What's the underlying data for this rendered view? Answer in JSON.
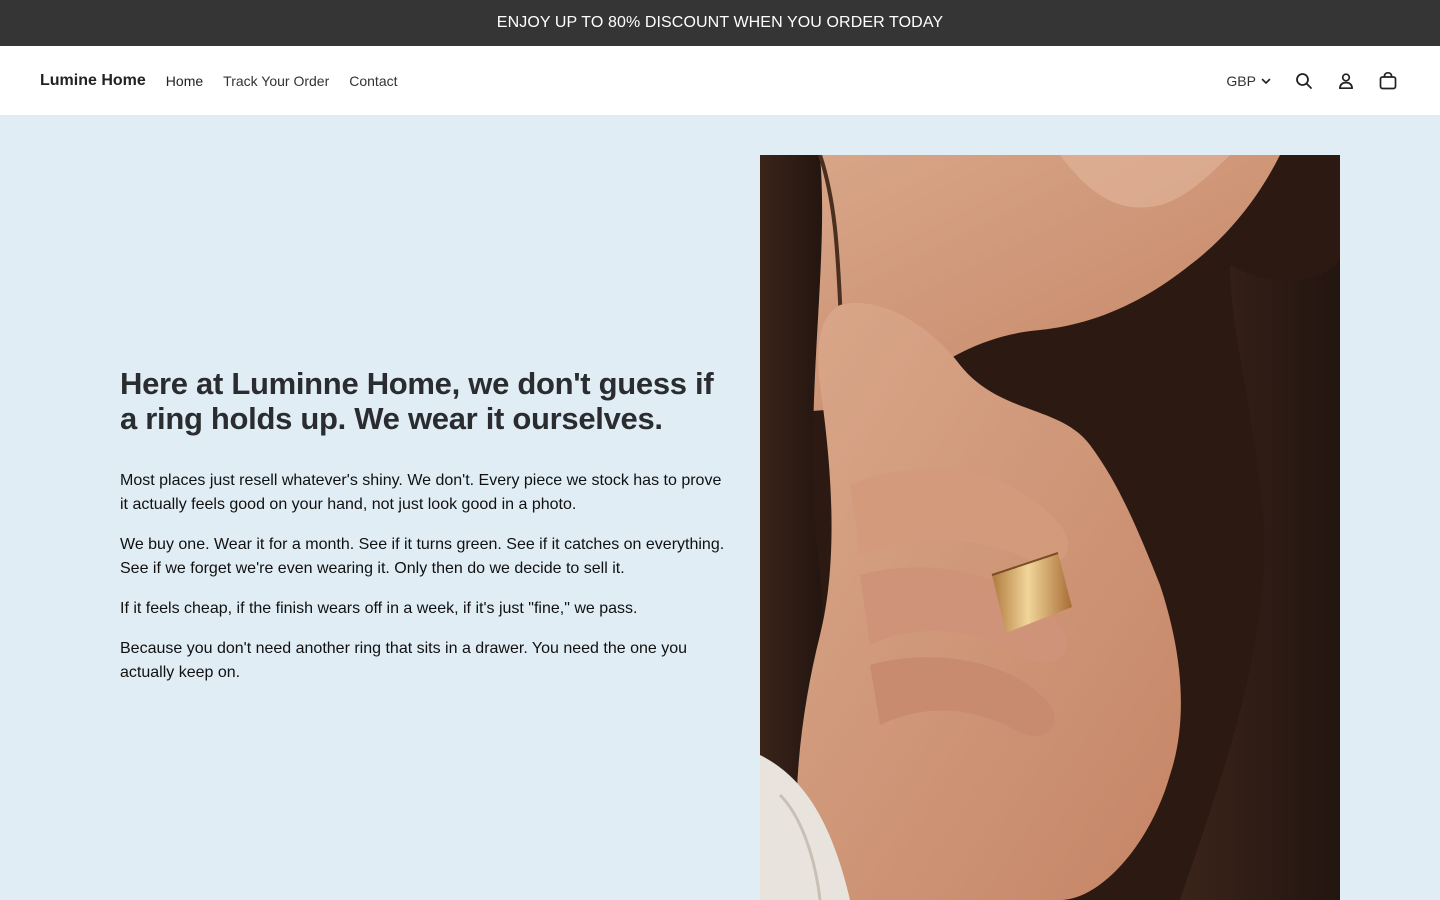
{
  "announcement": "ENJOY UP TO 80% DISCOUNT WHEN YOU ORDER TODAY",
  "header": {
    "logo": "Lumine Home",
    "nav": [
      {
        "label": "Home"
      },
      {
        "label": "Track Your Order"
      },
      {
        "label": "Contact"
      }
    ],
    "currency": "GBP",
    "icons": [
      "search-icon",
      "account-icon",
      "cart-icon"
    ]
  },
  "hero": {
    "title": "Here at Luminne Home, we don't guess if a ring holds up. We wear it ourselves.",
    "paragraphs": [
      "Most places just resell whatever's shiny. We don't. Every piece we stock has to prove it actually feels good on your hand, not just look good in a photo.",
      "We buy one. Wear it for a month. See if it turns green. See if it catches on everything. See if we forget we're even wearing it. Only then do we decide to sell it.",
      "If it feels cheap, if the finish wears off in a week, if it's just \"fine,\" we pass.",
      "Because you don't need another ring that sits in a drawer. You need the one you actually keep on."
    ]
  },
  "colors": {
    "announcement_bg": "#353535",
    "hero_bg": "#e0edf5",
    "title": "#2a2c30"
  }
}
